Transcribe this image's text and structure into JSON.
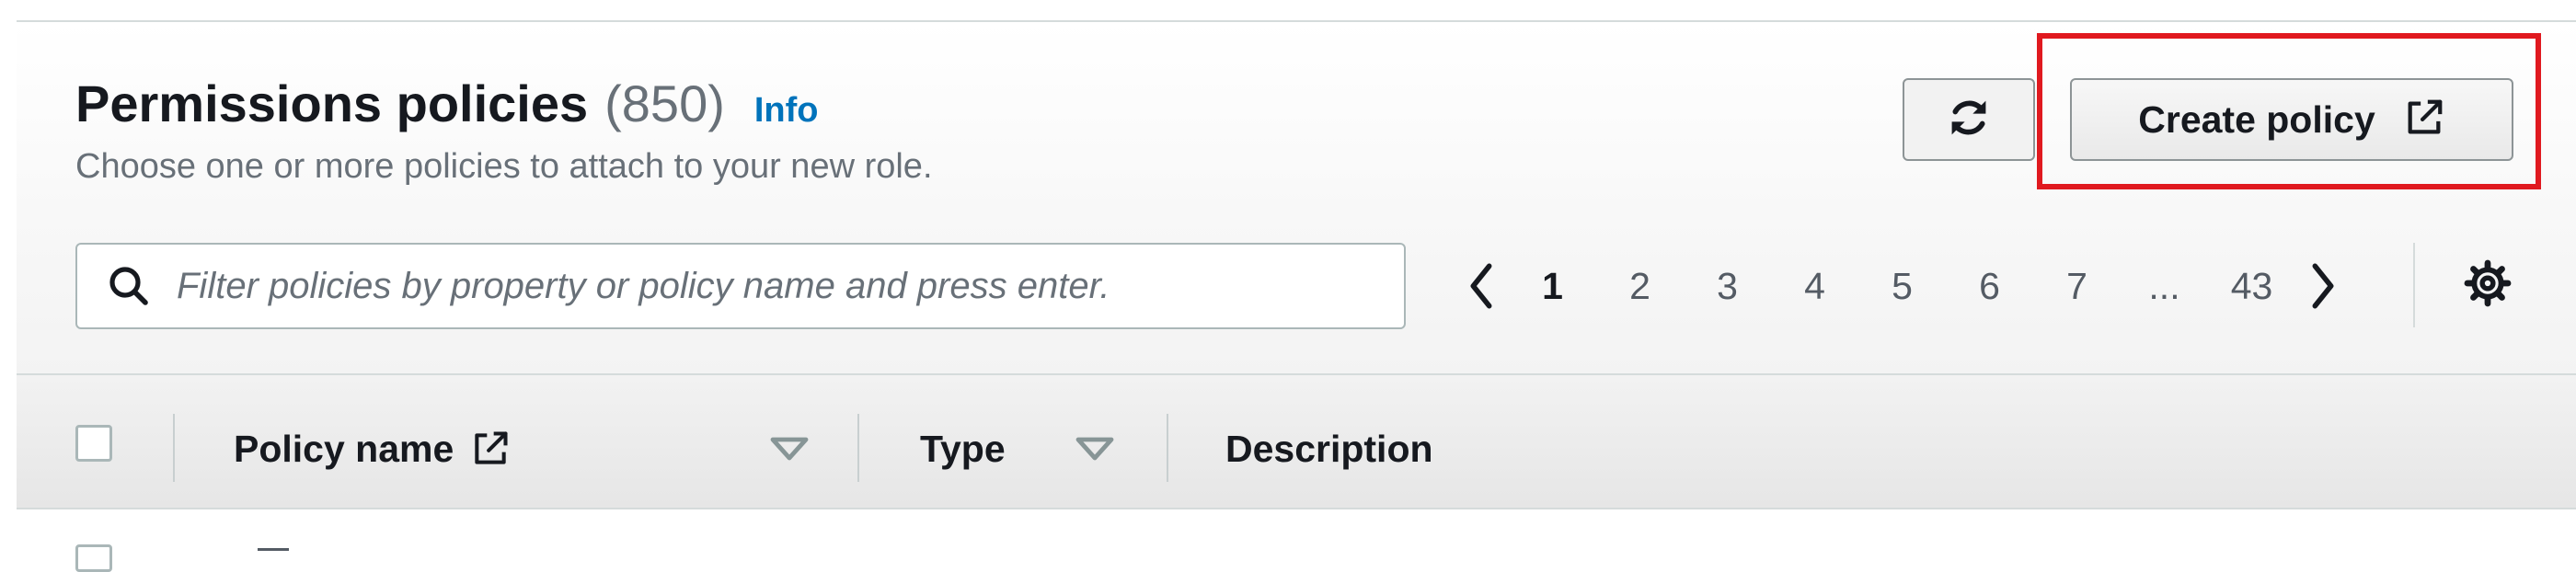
{
  "header": {
    "title": "Permissions policies",
    "count": "(850)",
    "info_link": "Info",
    "subtitle": "Choose one or more policies to attach to your new role."
  },
  "actions": {
    "refresh_icon": "refresh-icon",
    "create_policy_label": "Create policy",
    "create_policy_icon": "external-link-icon",
    "highlight_color": "#e0191f"
  },
  "search": {
    "value": "",
    "placeholder": "Filter policies by property or policy name and press enter.",
    "icon": "search-icon"
  },
  "pagination": {
    "current_page": "1",
    "pages": [
      "1",
      "2",
      "3",
      "4",
      "5",
      "6",
      "7",
      "...",
      "43"
    ],
    "prev_icon": "chevron-left-icon",
    "next_icon": "chevron-right-icon",
    "settings_icon": "gear-icon"
  },
  "table": {
    "columns": [
      {
        "label": "Policy name",
        "icon": "external-link-icon",
        "sortable": true
      },
      {
        "label": "Type",
        "sortable": true
      },
      {
        "label": "Description",
        "sortable": false
      }
    ]
  },
  "colors": {
    "text": "#16191f",
    "muted": "#687078",
    "link": "#0073bb",
    "border": "#aab7b8"
  }
}
